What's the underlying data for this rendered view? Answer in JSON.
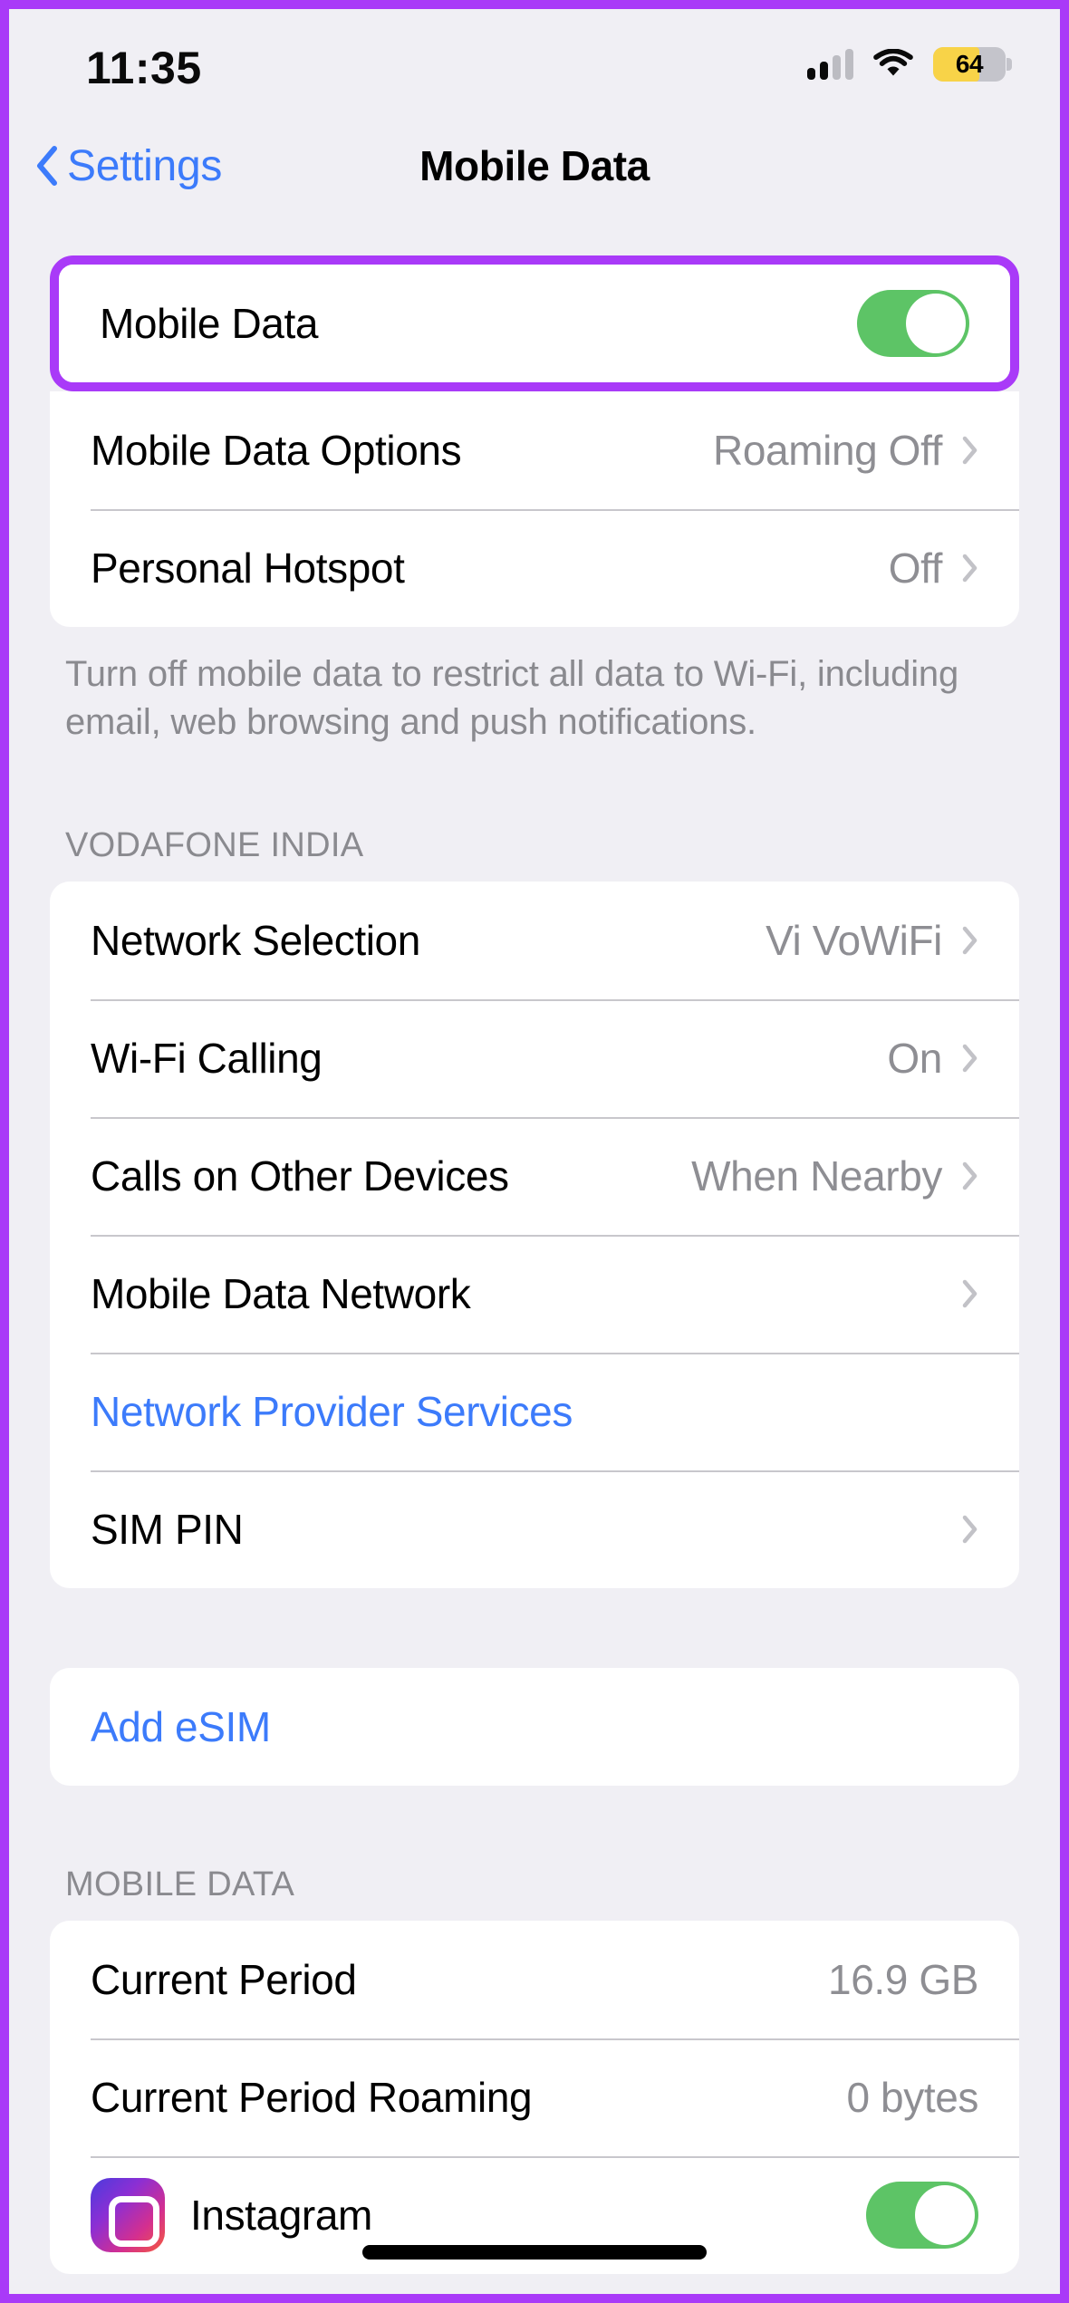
{
  "status_bar": {
    "time": "11:35",
    "battery_percent": "64",
    "battery_level": 64,
    "signal_bars_filled": 2,
    "signal_bars_total": 4,
    "wifi_icon": "wifi-icon",
    "battery_color": "#f8d348"
  },
  "nav": {
    "back_label": "Settings",
    "back_icon": "chevron-left-icon",
    "title": "Mobile Data"
  },
  "colors": {
    "accent_blue": "#3c7bfb",
    "toggle_on_green": "#5dc466",
    "highlight_purple": "#a93af8",
    "page_background": "#f0eff4",
    "secondary_text": "#8e8e93"
  },
  "sections": {
    "primary": {
      "highlighted_row": {
        "label": "Mobile Data",
        "toggle_state": "on"
      },
      "rows": [
        {
          "label": "Mobile Data Options",
          "value": "Roaming Off",
          "chevron": true
        },
        {
          "label": "Personal Hotspot",
          "value": "Off",
          "chevron": true
        }
      ],
      "footer": "Turn off mobile data to restrict all data to Wi-Fi, including email, web browsing and push notifications."
    },
    "carrier": {
      "header": "VODAFONE INDIA",
      "rows": [
        {
          "label": "Network Selection",
          "value": "Vi VoWiFi",
          "chevron": true,
          "is_link": false
        },
        {
          "label": "Wi-Fi Calling",
          "value": "On",
          "chevron": true,
          "is_link": false
        },
        {
          "label": "Calls on Other Devices",
          "value": "When Nearby",
          "chevron": true,
          "is_link": false
        },
        {
          "label": "Mobile Data Network",
          "value": "",
          "chevron": true,
          "is_link": false
        },
        {
          "label": "Network Provider Services",
          "value": "",
          "chevron": false,
          "is_link": true
        },
        {
          "label": "SIM PIN",
          "value": "",
          "chevron": true,
          "is_link": false
        }
      ]
    },
    "esim": {
      "rows": [
        {
          "label": "Add eSIM",
          "is_link": true
        }
      ]
    },
    "usage": {
      "header": "MOBILE DATA",
      "rows": [
        {
          "label": "Current Period",
          "value": "16.9 GB"
        },
        {
          "label": "Current Period Roaming",
          "value": "0 bytes"
        }
      ],
      "apps": [
        {
          "name": "Instagram",
          "icon": "instagram-icon",
          "toggle_state": "on"
        }
      ]
    }
  }
}
